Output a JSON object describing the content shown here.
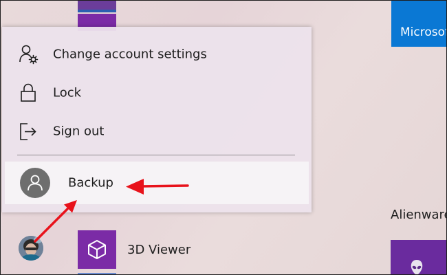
{
  "menu": {
    "items": [
      {
        "label": "Change account settings",
        "icon": "account-settings-icon"
      },
      {
        "label": "Lock",
        "icon": "lock-icon"
      },
      {
        "label": "Sign out",
        "icon": "sign-out-icon"
      }
    ],
    "account": {
      "label": "Backup",
      "icon": "person-icon"
    }
  },
  "tiles": {
    "microsoft_label": "Microsoft",
    "alienware_label": "Alienware",
    "viewer_label": "3D Viewer"
  },
  "colors": {
    "annotation_arrow": "#e8121b",
    "tile_purple": "#7b2ba6",
    "tile_blue": "#0a78d4"
  }
}
